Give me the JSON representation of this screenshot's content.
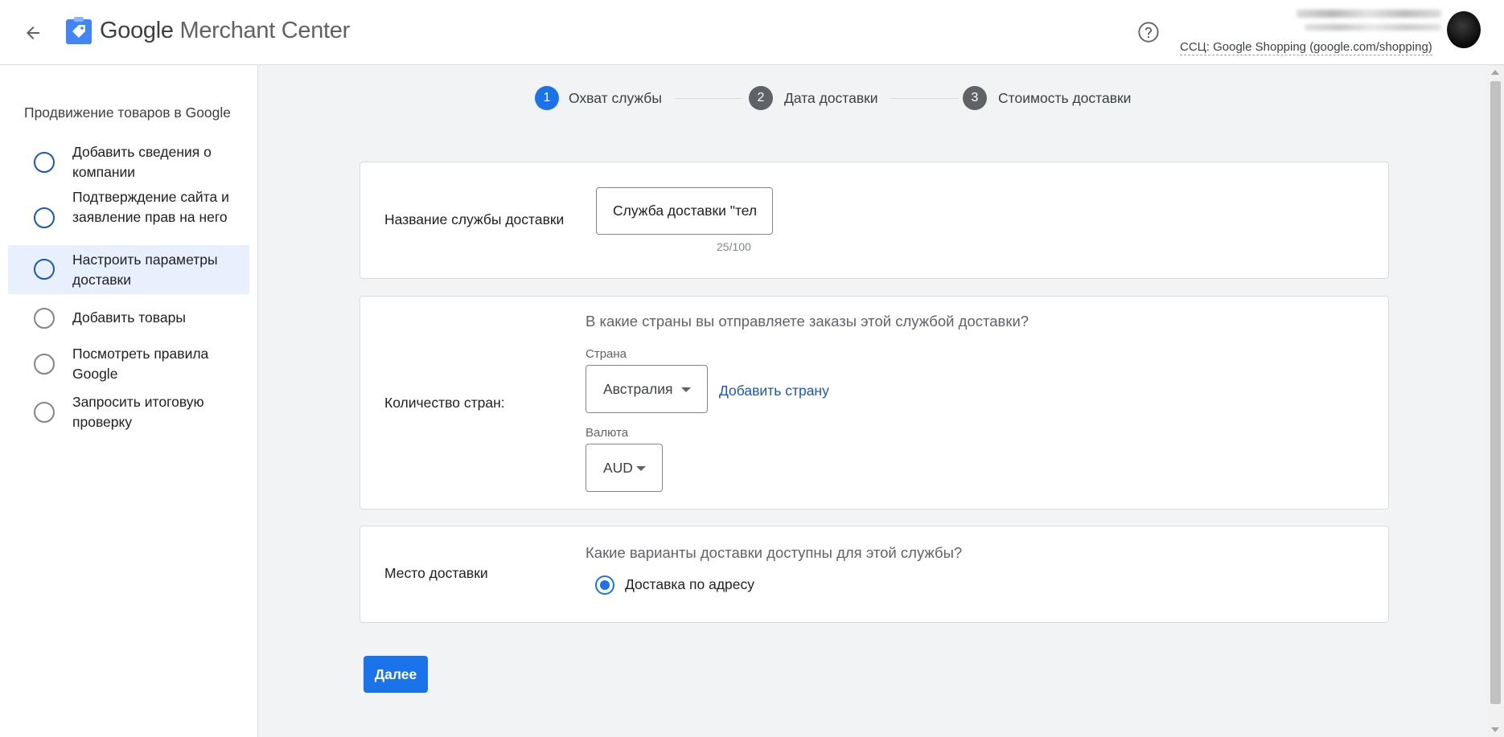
{
  "header": {
    "back_icon": "arrow-back-icon",
    "logo_icon": "merchant-center-logo-icon",
    "title_brand": "Google",
    "title_product": "Merchant Center",
    "help_icon": "help-circle-icon",
    "account_label": "CCЦ: Google Shopping (google.com/shopping)"
  },
  "sidebar": {
    "title": "Продвижение товаров в Google",
    "items": [
      {
        "label": "Добавить сведения о компании",
        "state": "in-progress"
      },
      {
        "label": "Подтверждение сайта и заявление прав на него",
        "state": "in-progress"
      },
      {
        "label": "Настроить параметры доставки",
        "state": "active"
      },
      {
        "label": "Добавить товары",
        "state": "not-started"
      },
      {
        "label": "Посмотреть правила Google",
        "state": "not-started"
      },
      {
        "label": "Запросить итоговую проверку",
        "state": "not-started"
      }
    ]
  },
  "stepper": {
    "steps": [
      {
        "num": "1",
        "label": "Охват службы",
        "active": true
      },
      {
        "num": "2",
        "label": "Дата доставки",
        "active": false
      },
      {
        "num": "3",
        "label": "Стоимость доставки",
        "active": false
      }
    ]
  },
  "service_name": {
    "label": "Название службы доставки",
    "value": "Служба доставки \"телемагазин\"",
    "char_count": "25/100"
  },
  "countries": {
    "label": "Количество стран:",
    "question": "В какие страны вы отправляете заказы этой службой доставки?",
    "country_label": "Страна",
    "country_value": "Австралия",
    "add_country": "Добавить страну",
    "currency_label": "Валюта",
    "currency_value": "AUD"
  },
  "delivery_location": {
    "label": "Место доставки",
    "question": "Какие варианты доставки доступны для этой службы?",
    "option": "Доставка по адресу",
    "selected": true
  },
  "actions": {
    "next_label": "Далее"
  },
  "colors": {
    "accent": "#1a73e8",
    "link": "#1a57b8",
    "active_bg": "#e8f0fe",
    "page_bg": "#f1f3f4"
  }
}
